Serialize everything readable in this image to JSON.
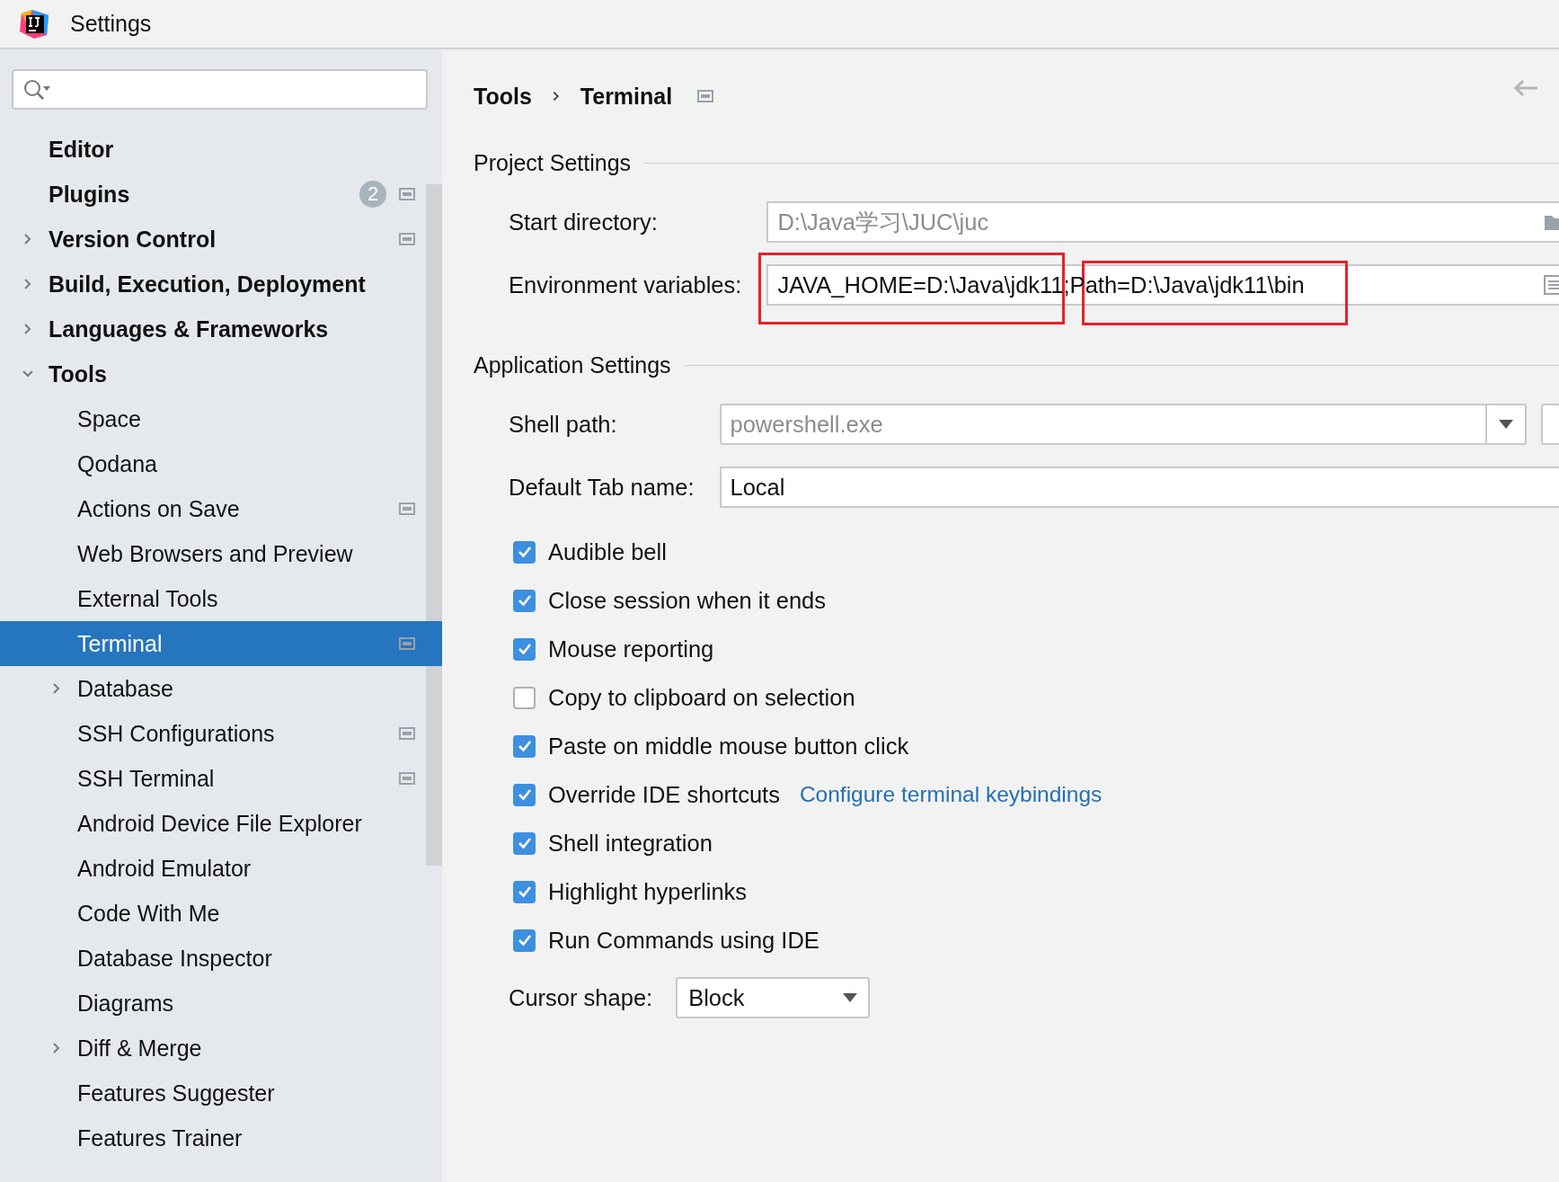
{
  "window": {
    "title": "Settings"
  },
  "sidebar": {
    "items": [
      {
        "label": "Editor",
        "selected": false,
        "project_level": false
      },
      {
        "label": "Plugins",
        "selected": false,
        "project_level": true,
        "badge": "2"
      },
      {
        "label": "Version Control",
        "selected": false,
        "project_level": true,
        "expanded": false
      },
      {
        "label": "Build, Execution, Deployment",
        "selected": false,
        "project_level": false,
        "expanded": false
      },
      {
        "label": "Languages & Frameworks",
        "selected": false,
        "project_level": false,
        "expanded": false
      },
      {
        "label": "Tools",
        "selected": false,
        "project_level": false,
        "expanded": true,
        "children": [
          {
            "label": "Space",
            "selected": false,
            "project_level": false
          },
          {
            "label": "Qodana",
            "selected": false,
            "project_level": false
          },
          {
            "label": "Actions on Save",
            "selected": false,
            "project_level": true
          },
          {
            "label": "Web Browsers and Preview",
            "selected": false,
            "project_level": false
          },
          {
            "label": "External Tools",
            "selected": false,
            "project_level": false
          },
          {
            "label": "Terminal",
            "selected": true,
            "project_level": true
          },
          {
            "label": "Database",
            "selected": false,
            "project_level": false,
            "expanded": false
          },
          {
            "label": "SSH Configurations",
            "selected": false,
            "project_level": true
          },
          {
            "label": "SSH Terminal",
            "selected": false,
            "project_level": true
          },
          {
            "label": "Android Device File Explorer",
            "selected": false,
            "project_level": false
          },
          {
            "label": "Android Emulator",
            "selected": false,
            "project_level": false
          },
          {
            "label": "Code With Me",
            "selected": false,
            "project_level": false
          },
          {
            "label": "Database Inspector",
            "selected": false,
            "project_level": false
          },
          {
            "label": "Diagrams",
            "selected": false,
            "project_level": false
          },
          {
            "label": "Diff & Merge",
            "selected": false,
            "project_level": false,
            "expanded": false
          },
          {
            "label": "Features Suggester",
            "selected": false,
            "project_level": false
          },
          {
            "label": "Features Trainer",
            "selected": false,
            "project_level": false
          }
        ]
      }
    ]
  },
  "breadcrumb": [
    "Tools",
    "Terminal"
  ],
  "project_settings": {
    "title": "Project Settings",
    "rows": [
      {
        "kind": "path",
        "label": "Start directory:",
        "placeholder": "D:\\Java学习\\JUC\\juc"
      },
      {
        "kind": "env",
        "label": "Environment variables:",
        "value": "JAVA_HOME=D:\\Java\\jdk11;Path=D:\\Java\\jdk11\\bin"
      }
    ]
  },
  "application_settings": {
    "title": "Application Settings",
    "rows": [
      {
        "kind": "combo",
        "label": "Shell path:",
        "placeholder": "powershell.exe"
      },
      {
        "kind": "text",
        "label": "Default Tab name:",
        "value": "Local"
      }
    ],
    "options": [
      {
        "label": "Audible bell",
        "checked": true
      },
      {
        "label": "Close session when it ends",
        "checked": true
      },
      {
        "label": "Mouse reporting",
        "checked": true
      },
      {
        "label": "Copy to clipboard on selection",
        "checked": false
      },
      {
        "label": "Paste on middle mouse button click",
        "checked": true
      },
      {
        "label": "Override IDE shortcuts",
        "checked": true,
        "link": "Configure terminal keybindings"
      },
      {
        "label": "Shell integration",
        "checked": true
      },
      {
        "label": "Highlight hyperlinks",
        "checked": true
      },
      {
        "label": "Run Commands using IDE",
        "checked": true
      }
    ],
    "cursor_shape": {
      "label": "Cursor shape:",
      "value": "Block"
    }
  }
}
